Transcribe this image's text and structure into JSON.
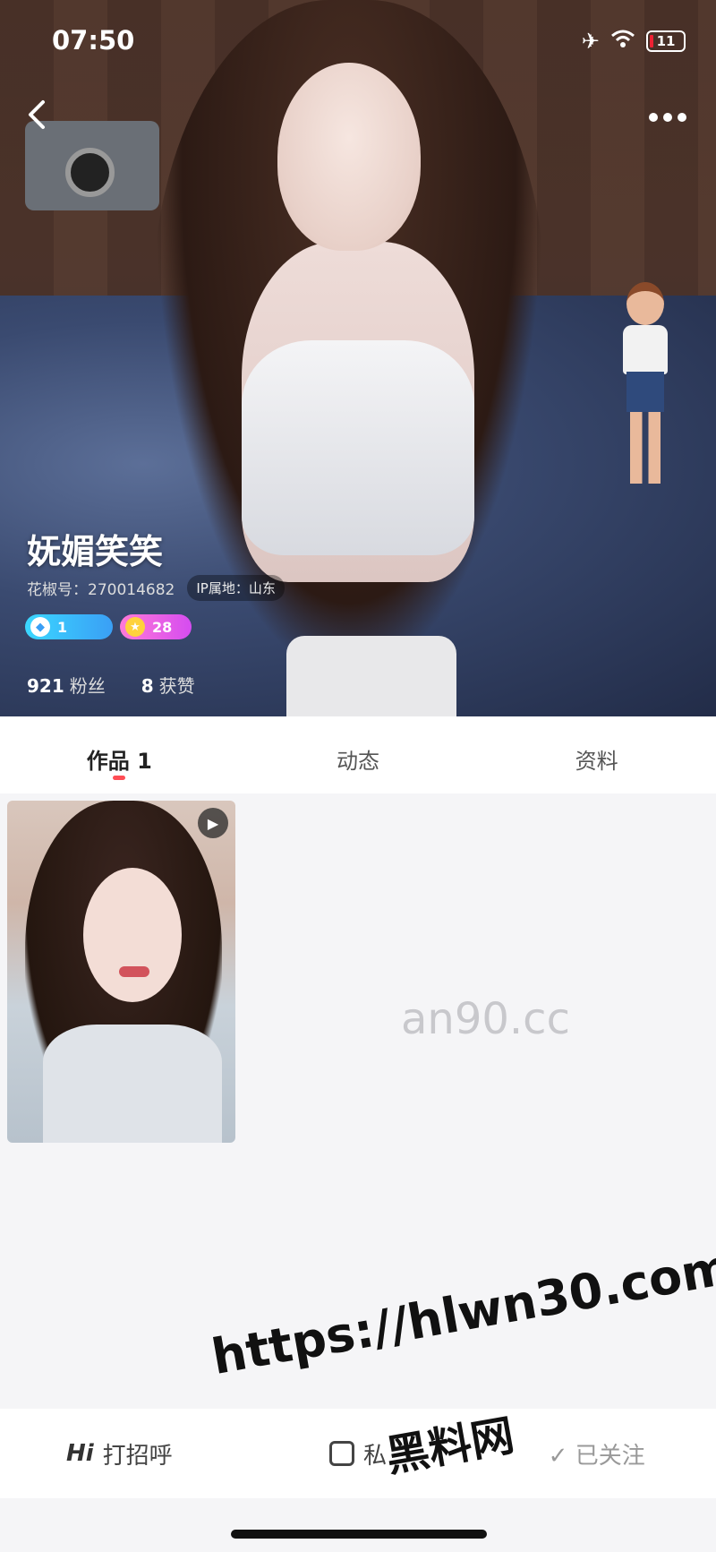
{
  "status_bar": {
    "time": "07:50",
    "battery": "11"
  },
  "profile": {
    "name": "妩媚笑笑",
    "id_label": "花椒号：270014682",
    "ip_label": "IP属地：山东",
    "badge_level_1": "1",
    "badge_level_2": "28",
    "fans_count": "921",
    "fans_label": "粉丝",
    "likes_count": "8",
    "likes_label": "获赞"
  },
  "tabs": [
    {
      "label": "作品 1"
    },
    {
      "label": "动态"
    },
    {
      "label": "资料"
    }
  ],
  "watermark": "an90.cc",
  "bottom_bar": {
    "hi_icon": "Hi",
    "greet_label": "打招呼",
    "message_label": "私",
    "follow_label": "✓ 已关注"
  },
  "overlay": {
    "url": "https://hlwn30.com",
    "site_name": "黑料网"
  },
  "icons": {
    "back": "chevron-left-icon",
    "more": "ellipsis-icon",
    "play": "play-icon",
    "airplane": "airplane-icon",
    "wifi": "wifi-icon"
  }
}
